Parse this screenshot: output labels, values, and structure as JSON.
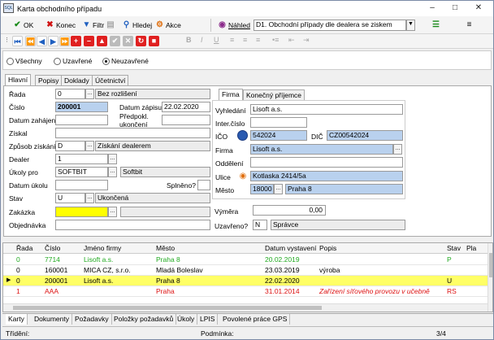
{
  "window": {
    "title": "Karta obchodního případu",
    "app_icon": "SQL"
  },
  "toolbar": {
    "ok": "OK",
    "konec": "Konec",
    "filtr": "Filtr",
    "hledej": "Hledej",
    "akce": "Akce",
    "nahled": "Náhled",
    "selected_view": "D1. Obchodní případy dle dealera se ziskem"
  },
  "filters": {
    "all": "Všechny",
    "closed": "Uzavřené",
    "open": "Neuzavřené",
    "selected": "open"
  },
  "tabs": {
    "hlavni": "Hlavní",
    "popisy": "Popisy",
    "doklady": "Doklady",
    "ucetnictvi": "Účetnictví"
  },
  "form": {
    "rada_label": "Řada",
    "rada_value": "0",
    "rada_desc": "Bez rozlišení",
    "cislo_label": "Číslo",
    "cislo_value": "200001",
    "datum_zapisu_label": "Datum zápisu",
    "datum_zapisu_value": "22.02.2020",
    "datum_zahajeni_label": "Datum zahájení",
    "predpokl_label": "Předpokl.",
    "ukonceni_label": "ukončení",
    "ziskal_label": "Získal",
    "zpusob_label": "Způsob získání",
    "zpusob_value": "D",
    "zpusob_desc": "Získání dealerem",
    "dealer_label": "Dealer",
    "dealer_value": "1",
    "ukoly_label": "Úkoly pro",
    "ukoly_value": "SOFTBIT",
    "ukoly_desc": "Softbit",
    "datum_ukolu_label": "Datum úkolu",
    "splneno_label": "Splněno?",
    "stav_label": "Stav",
    "stav_value": "U",
    "stav_desc": "Ukončená",
    "zakazka_label": "Zakázka",
    "objednavka_label": "Objednávka"
  },
  "firm_tabs": {
    "firma": "Firma",
    "konecny": "Konečný příjemce"
  },
  "firm": {
    "vyhledani_label": "Vyhledání",
    "vyhledani_value": "Lisoft a.s.",
    "inter_label": "Inter.číslo",
    "ico_label": "IČO",
    "ico_value": "542024",
    "dic_label": "DIČ",
    "dic_value": "CZ00542024",
    "firma_label": "Firma",
    "firma_value": "Lisoft a.s.",
    "oddeleni_label": "Oddělení",
    "ulice_label": "Ulice",
    "ulice_value": "Kotlaska 2414/5a",
    "mesto_label": "Město",
    "mesto_psc": "18000",
    "mesto_value": "Praha 8",
    "vymera_label": "Výměra",
    "vymera_value": "0,00",
    "uzavreno_label": "Uzavřeno?",
    "uzavreno_value": "N",
    "uzavreno_desc": "Správce"
  },
  "grid": {
    "columns": [
      "Řada",
      "Číslo",
      "Jméno firmy",
      "Město",
      "Datum vystavení",
      "Popis",
      "Stav",
      "Pla"
    ],
    "rows": [
      {
        "rada": "0",
        "cislo": "7714",
        "firma": "Lisoft a.s.",
        "mesto": "Praha 8",
        "datum": "20.02.2019",
        "popis": "",
        "stav": "P",
        "color": "#22aa22"
      },
      {
        "rada": "0",
        "cislo": "160001",
        "firma": "MICA CZ, s.r.o.",
        "mesto": "Mladá Boleslav",
        "datum": "23.03.2019",
        "popis": "výroba",
        "stav": "",
        "color": "#000000"
      },
      {
        "rada": "0",
        "cislo": "200001",
        "firma": "Lisoft a.s.",
        "mesto": "Praha 8",
        "datum": "22.02.2020",
        "popis": "",
        "stav": "U",
        "color": "#000000"
      },
      {
        "rada": "1",
        "cislo": "AAA",
        "firma": "",
        "mesto": "Praha",
        "datum": "31.01.2014",
        "popis": "Zařízení síťového provozu v učebně",
        "stav": "RS",
        "color": "#dd1111"
      }
    ]
  },
  "bottom_tabs": [
    "Karty",
    "Dokumenty",
    "Požadavky",
    "Položky požadavků",
    "Úkoly",
    "LPIS",
    "Povolené práce GPS"
  ],
  "status": {
    "trideni": "Třídění:",
    "podminka": "Podmínka:",
    "pager": "3/4"
  }
}
